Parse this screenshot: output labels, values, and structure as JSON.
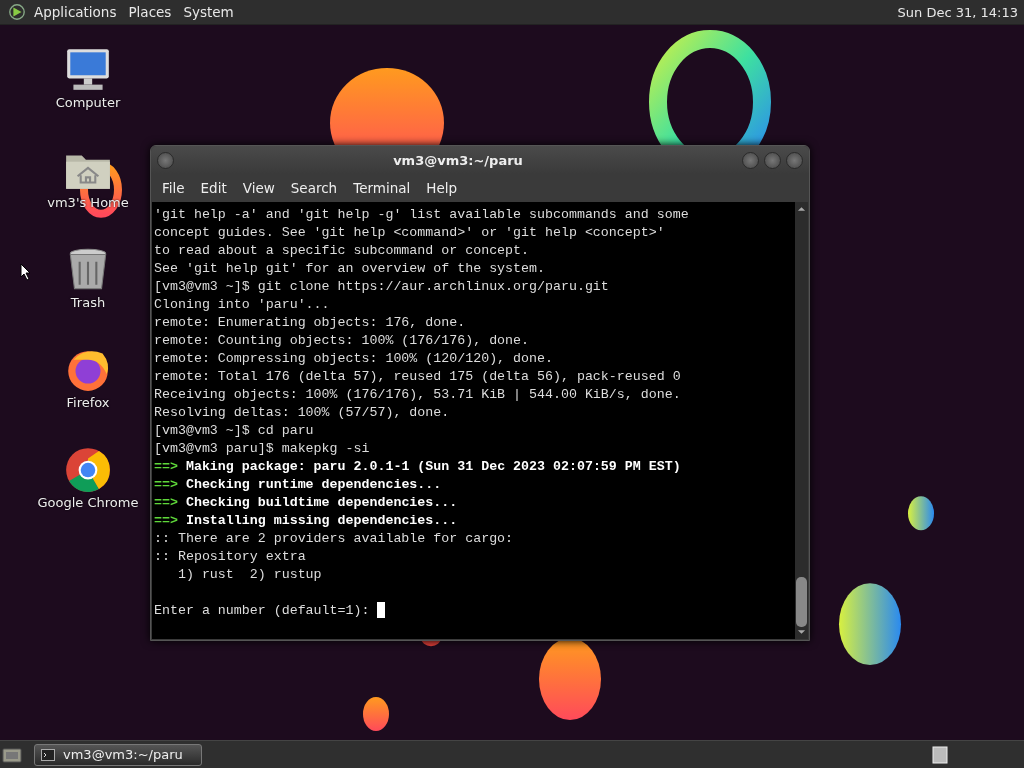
{
  "top_panel": {
    "menus": [
      "Applications",
      "Places",
      "System"
    ],
    "clock": "Sun Dec 31, 14:13"
  },
  "desktop_icons": [
    {
      "kind": "computer",
      "label": "Computer"
    },
    {
      "kind": "home",
      "label": "vm3's Home"
    },
    {
      "kind": "trash",
      "label": "Trash"
    },
    {
      "kind": "firefox",
      "label": "Firefox"
    },
    {
      "kind": "chrome",
      "label": "Google Chrome"
    }
  ],
  "terminal": {
    "title": "vm3@vm3:~/paru",
    "menu": [
      "File",
      "Edit",
      "View",
      "Search",
      "Terminal",
      "Help"
    ],
    "lines": [
      {
        "kind": "plain",
        "text": "'git help -a' and 'git help -g' list available subcommands and some"
      },
      {
        "kind": "plain",
        "text": "concept guides. See 'git help <command>' or 'git help <concept>'"
      },
      {
        "kind": "plain",
        "text": "to read about a specific subcommand or concept."
      },
      {
        "kind": "plain",
        "text": "See 'git help git' for an overview of the system."
      },
      {
        "kind": "plain",
        "text": "[vm3@vm3 ~]$ git clone https://aur.archlinux.org/paru.git"
      },
      {
        "kind": "plain",
        "text": "Cloning into 'paru'..."
      },
      {
        "kind": "plain",
        "text": "remote: Enumerating objects: 176, done."
      },
      {
        "kind": "plain",
        "text": "remote: Counting objects: 100% (176/176), done."
      },
      {
        "kind": "plain",
        "text": "remote: Compressing objects: 100% (120/120), done."
      },
      {
        "kind": "plain",
        "text": "remote: Total 176 (delta 57), reused 175 (delta 56), pack-reused 0"
      },
      {
        "kind": "plain",
        "text": "Receiving objects: 100% (176/176), 53.71 KiB | 544.00 KiB/s, done."
      },
      {
        "kind": "plain",
        "text": "Resolving deltas: 100% (57/57), done."
      },
      {
        "kind": "plain",
        "text": "[vm3@vm3 ~]$ cd paru"
      },
      {
        "kind": "plain",
        "text": "[vm3@vm3 paru]$ makepkg -si"
      },
      {
        "kind": "step",
        "arrow": "==>",
        "text": "Making package: paru 2.0.1-1 (Sun 31 Dec 2023 02:07:59 PM EST)"
      },
      {
        "kind": "step",
        "arrow": "==>",
        "text": "Checking runtime dependencies..."
      },
      {
        "kind": "step",
        "arrow": "==>",
        "text": "Checking buildtime dependencies..."
      },
      {
        "kind": "step",
        "arrow": "==>",
        "text": "Installing missing dependencies..."
      },
      {
        "kind": "plain",
        "text": ":: There are 2 providers available for cargo:"
      },
      {
        "kind": "plain",
        "text": ":: Repository extra"
      },
      {
        "kind": "plain",
        "text": "   1) rust  2) rustup"
      },
      {
        "kind": "blank"
      },
      {
        "kind": "prompt",
        "text": "Enter a number (default=1): "
      }
    ]
  },
  "taskbar": {
    "tasks": [
      {
        "label": "vm3@vm3:~/paru",
        "selected": true
      }
    ]
  }
}
